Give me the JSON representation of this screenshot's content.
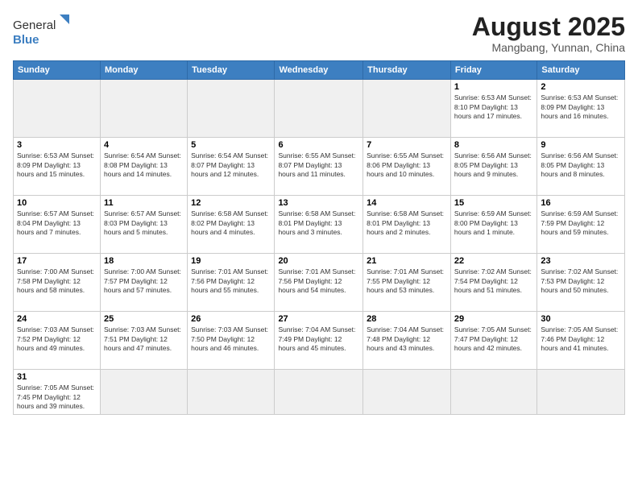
{
  "logo": {
    "text_general": "General",
    "text_blue": "Blue"
  },
  "title": "August 2025",
  "location": "Mangbang, Yunnan, China",
  "days_of_week": [
    "Sunday",
    "Monday",
    "Tuesday",
    "Wednesday",
    "Thursday",
    "Friday",
    "Saturday"
  ],
  "weeks": [
    [
      {
        "day": "",
        "info": ""
      },
      {
        "day": "",
        "info": ""
      },
      {
        "day": "",
        "info": ""
      },
      {
        "day": "",
        "info": ""
      },
      {
        "day": "",
        "info": ""
      },
      {
        "day": "1",
        "info": "Sunrise: 6:53 AM\nSunset: 8:10 PM\nDaylight: 13 hours and 17 minutes."
      },
      {
        "day": "2",
        "info": "Sunrise: 6:53 AM\nSunset: 8:09 PM\nDaylight: 13 hours and 16 minutes."
      }
    ],
    [
      {
        "day": "3",
        "info": "Sunrise: 6:53 AM\nSunset: 8:09 PM\nDaylight: 13 hours and 15 minutes."
      },
      {
        "day": "4",
        "info": "Sunrise: 6:54 AM\nSunset: 8:08 PM\nDaylight: 13 hours and 14 minutes."
      },
      {
        "day": "5",
        "info": "Sunrise: 6:54 AM\nSunset: 8:07 PM\nDaylight: 13 hours and 12 minutes."
      },
      {
        "day": "6",
        "info": "Sunrise: 6:55 AM\nSunset: 8:07 PM\nDaylight: 13 hours and 11 minutes."
      },
      {
        "day": "7",
        "info": "Sunrise: 6:55 AM\nSunset: 8:06 PM\nDaylight: 13 hours and 10 minutes."
      },
      {
        "day": "8",
        "info": "Sunrise: 6:56 AM\nSunset: 8:05 PM\nDaylight: 13 hours and 9 minutes."
      },
      {
        "day": "9",
        "info": "Sunrise: 6:56 AM\nSunset: 8:05 PM\nDaylight: 13 hours and 8 minutes."
      }
    ],
    [
      {
        "day": "10",
        "info": "Sunrise: 6:57 AM\nSunset: 8:04 PM\nDaylight: 13 hours and 7 minutes."
      },
      {
        "day": "11",
        "info": "Sunrise: 6:57 AM\nSunset: 8:03 PM\nDaylight: 13 hours and 5 minutes."
      },
      {
        "day": "12",
        "info": "Sunrise: 6:58 AM\nSunset: 8:02 PM\nDaylight: 13 hours and 4 minutes."
      },
      {
        "day": "13",
        "info": "Sunrise: 6:58 AM\nSunset: 8:01 PM\nDaylight: 13 hours and 3 minutes."
      },
      {
        "day": "14",
        "info": "Sunrise: 6:58 AM\nSunset: 8:01 PM\nDaylight: 13 hours and 2 minutes."
      },
      {
        "day": "15",
        "info": "Sunrise: 6:59 AM\nSunset: 8:00 PM\nDaylight: 13 hours and 1 minute."
      },
      {
        "day": "16",
        "info": "Sunrise: 6:59 AM\nSunset: 7:59 PM\nDaylight: 12 hours and 59 minutes."
      }
    ],
    [
      {
        "day": "17",
        "info": "Sunrise: 7:00 AM\nSunset: 7:58 PM\nDaylight: 12 hours and 58 minutes."
      },
      {
        "day": "18",
        "info": "Sunrise: 7:00 AM\nSunset: 7:57 PM\nDaylight: 12 hours and 57 minutes."
      },
      {
        "day": "19",
        "info": "Sunrise: 7:01 AM\nSunset: 7:56 PM\nDaylight: 12 hours and 55 minutes."
      },
      {
        "day": "20",
        "info": "Sunrise: 7:01 AM\nSunset: 7:56 PM\nDaylight: 12 hours and 54 minutes."
      },
      {
        "day": "21",
        "info": "Sunrise: 7:01 AM\nSunset: 7:55 PM\nDaylight: 12 hours and 53 minutes."
      },
      {
        "day": "22",
        "info": "Sunrise: 7:02 AM\nSunset: 7:54 PM\nDaylight: 12 hours and 51 minutes."
      },
      {
        "day": "23",
        "info": "Sunrise: 7:02 AM\nSunset: 7:53 PM\nDaylight: 12 hours and 50 minutes."
      }
    ],
    [
      {
        "day": "24",
        "info": "Sunrise: 7:03 AM\nSunset: 7:52 PM\nDaylight: 12 hours and 49 minutes."
      },
      {
        "day": "25",
        "info": "Sunrise: 7:03 AM\nSunset: 7:51 PM\nDaylight: 12 hours and 47 minutes."
      },
      {
        "day": "26",
        "info": "Sunrise: 7:03 AM\nSunset: 7:50 PM\nDaylight: 12 hours and 46 minutes."
      },
      {
        "day": "27",
        "info": "Sunrise: 7:04 AM\nSunset: 7:49 PM\nDaylight: 12 hours and 45 minutes."
      },
      {
        "day": "28",
        "info": "Sunrise: 7:04 AM\nSunset: 7:48 PM\nDaylight: 12 hours and 43 minutes."
      },
      {
        "day": "29",
        "info": "Sunrise: 7:05 AM\nSunset: 7:47 PM\nDaylight: 12 hours and 42 minutes."
      },
      {
        "day": "30",
        "info": "Sunrise: 7:05 AM\nSunset: 7:46 PM\nDaylight: 12 hours and 41 minutes."
      }
    ],
    [
      {
        "day": "31",
        "info": "Sunrise: 7:05 AM\nSunset: 7:45 PM\nDaylight: 12 hours and 39 minutes."
      },
      {
        "day": "",
        "info": ""
      },
      {
        "day": "",
        "info": ""
      },
      {
        "day": "",
        "info": ""
      },
      {
        "day": "",
        "info": ""
      },
      {
        "day": "",
        "info": ""
      },
      {
        "day": "",
        "info": ""
      }
    ]
  ]
}
